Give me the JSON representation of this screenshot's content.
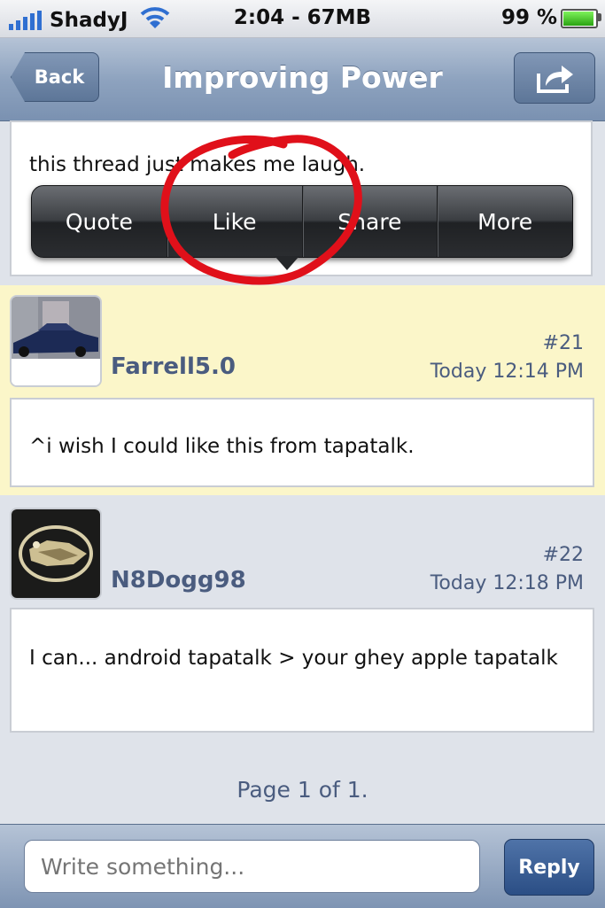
{
  "status_bar": {
    "carrier": "ShadyJ",
    "time": "2:04 - 67MB",
    "battery_text": "99 %",
    "battery_level": 0.99
  },
  "nav": {
    "back_label": "Back",
    "title": "Improving Power",
    "share_icon": "share-arrow-icon"
  },
  "first_post": {
    "text": "this thread just makes me laugh."
  },
  "context_menu": {
    "items": [
      "Quote",
      "Like",
      "Share",
      "More"
    ],
    "annotation_color": "#e0101a"
  },
  "posts": [
    {
      "username": "Farrell5.0",
      "number": "#21",
      "time": "Today 12:14 PM",
      "body": "^i wish I could like this from tapatalk.",
      "highlight_color": "#fbf6c9"
    },
    {
      "username": "N8Dogg98",
      "number": "#22",
      "time": "Today 12:18 PM",
      "body": "I can... android tapatalk > your ghey apple tapatalk"
    }
  ],
  "pagination": {
    "text": "Page 1 of 1."
  },
  "compose": {
    "placeholder": "Write something...",
    "reply_label": "Reply"
  }
}
